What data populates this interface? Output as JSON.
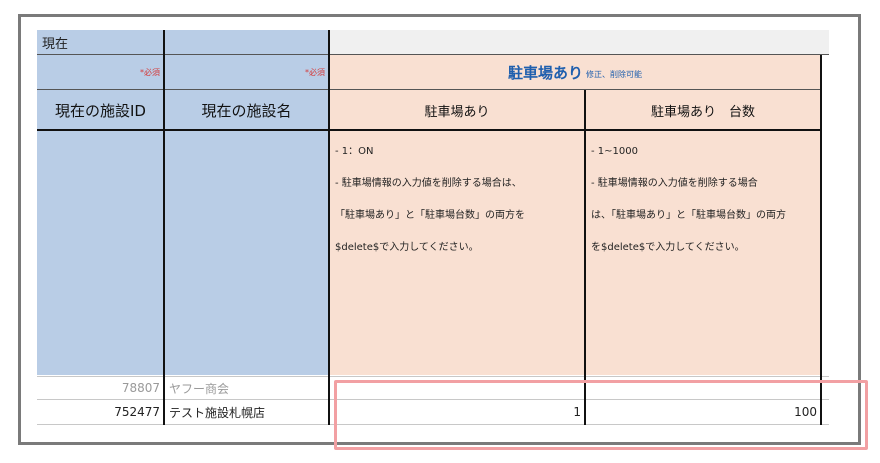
{
  "header": {
    "section_label": "現在"
  },
  "required_marks": {
    "left": "*必須",
    "right": "*必須"
  },
  "merged_header": {
    "title": "駐車場あり",
    "note": "修正、削除可能"
  },
  "columns": {
    "facility_id": "現在の施設ID",
    "facility_name": "現在の施設名",
    "parking": "駐車場あり",
    "parking_count": "駐車場あり　台数"
  },
  "descriptions": {
    "parking": [
      "- 1：ON",
      "- 駐車場情報の入力値を削除する場合は、",
      "「駐車場あり」と「駐車場台数」の両方を",
      "$delete$で入力してください。"
    ],
    "parking_count": [
      "- 1~1000",
      "- 駐車場情報の入力値を削除する場合",
      "は、「駐車場あり」と「駐車場台数」の両方",
      "を$delete$で入力してください。"
    ]
  },
  "rows": [
    {
      "id": "78807",
      "name": "ヤフー商会",
      "parking": "",
      "count": ""
    },
    {
      "id": "752477",
      "name": "テスト施設札幌店",
      "parking": "1",
      "count": "100"
    }
  ],
  "colors": {
    "header_blue": "#b9cde6",
    "peach": "#f9e0d2",
    "required_red": "#d43c3c",
    "title_blue": "#1f5fae",
    "highlight_pink": "#f2a0a3"
  }
}
